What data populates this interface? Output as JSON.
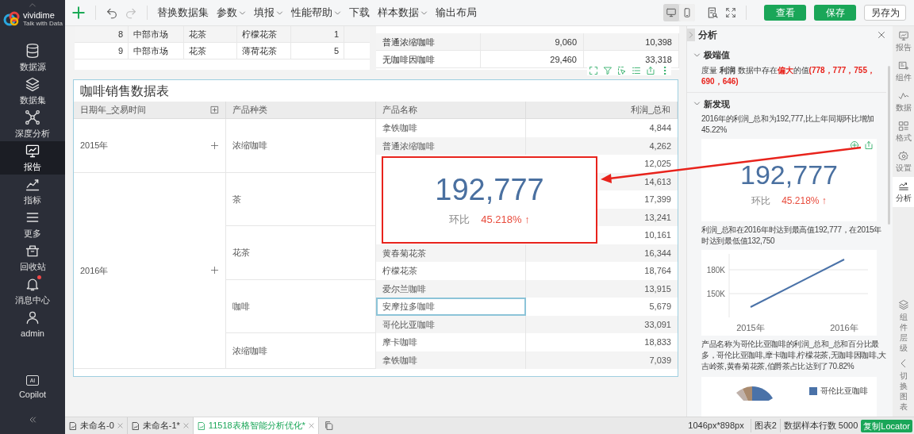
{
  "sidebar": {
    "logo": {
      "name": "vividime",
      "tagline": "Talk with Data"
    },
    "items": [
      {
        "label": "数据源",
        "selected": false,
        "badge": false
      },
      {
        "label": "数据集",
        "selected": false,
        "badge": false
      },
      {
        "label": "深度分析",
        "selected": false,
        "badge": false
      },
      {
        "label": "报告",
        "selected": true,
        "badge": false
      },
      {
        "label": "指标",
        "selected": false,
        "badge": false
      },
      {
        "label": "更多",
        "selected": false,
        "badge": false
      },
      {
        "label": "回收站",
        "selected": false,
        "badge": false
      },
      {
        "label": "消息中心",
        "selected": false,
        "badge": true
      },
      {
        "label": "admin",
        "selected": false,
        "badge": false
      }
    ],
    "copilot": {
      "icon_text": "AI",
      "label": "Copilot"
    }
  },
  "toolbar": {
    "menus": [
      {
        "label": "替换数据集",
        "dropdown": false
      },
      {
        "label": "参数",
        "dropdown": true
      },
      {
        "label": "填报",
        "dropdown": true
      },
      {
        "label": "性能帮助",
        "dropdown": true
      },
      {
        "label": "下载",
        "dropdown": false
      },
      {
        "label": "样本数据",
        "dropdown": true
      },
      {
        "label": "输出布局",
        "dropdown": false
      }
    ],
    "view_modes": [
      {
        "kind": "desktop",
        "selected": true
      },
      {
        "kind": "mobile",
        "selected": false
      }
    ],
    "buttons": [
      {
        "label": "查看",
        "kind": "primary"
      },
      {
        "label": "保存",
        "kind": "primary"
      },
      {
        "label": "另存为",
        "kind": "secondary"
      }
    ]
  },
  "canvas": {
    "top_left_table": {
      "rows": [
        [
          "8",
          "中部市场",
          "花茶",
          "柠檬花茶",
          "1"
        ],
        [
          "9",
          "中部市场",
          "花茶",
          "薄荷花茶",
          "5"
        ]
      ]
    },
    "top_right_table": {
      "rows": [
        [
          "普通浓缩咖啡",
          "9,060",
          "10,398"
        ],
        [
          "无咖啡因咖啡",
          "29,460",
          "33,318"
        ]
      ]
    },
    "widget": {
      "title": "咖啡销售数据表",
      "columns": [
        "日期年_交易时间",
        "产品种类",
        "产品名称",
        "利润_总和"
      ],
      "years": [
        {
          "label": "2015年",
          "categories": [
            {
              "label": "浓缩咖啡",
              "products": [
                {
                  "name": "拿铁咖啡",
                  "value": "4,844",
                  "selected": false
                },
                {
                  "name": "普通浓缩咖啡",
                  "value": "4,262",
                  "selected": false
                },
                {
                  "value": "12,025"
                }
              ]
            }
          ]
        },
        {
          "label": "2016年",
          "categories": [
            {
              "label": "茶",
              "products": [
                {
                  "value": "14,613"
                },
                {
                  "value": "17,399"
                },
                {
                  "value": "13,241"
                }
              ]
            },
            {
              "label": "花茶",
              "products": [
                {
                  "value": "10,161"
                },
                {
                  "name": "黄春菊花茶",
                  "value": "16,344",
                  "selected": false
                },
                {
                  "name": "柠檬花茶",
                  "value": "18,764",
                  "selected": false
                }
              ]
            },
            {
              "label": "咖啡",
              "products": [
                {
                  "name": "爱尔兰咖啡",
                  "value": "13,915",
                  "selected": false
                },
                {
                  "name": "安摩拉多咖啡",
                  "value": "5,679",
                  "selected": true
                },
                {
                  "name": "哥伦比亚咖啡",
                  "value": "33,091",
                  "selected": false
                }
              ]
            },
            {
              "label": "浓缩咖啡",
              "products": [
                {
                  "name": "摩卡咖啡",
                  "value": "18,833",
                  "selected": false
                },
                {
                  "name": "拿铁咖啡",
                  "value": "7,039",
                  "selected": false
                }
              ]
            }
          ]
        }
      ],
      "kpi_overlay": {
        "value": "192,777",
        "compare_label": "环比",
        "compare_value": "45.218% ↑"
      }
    }
  },
  "analysis_panel": {
    "title": "分析",
    "extremes": {
      "title": "极端值",
      "expanded": true,
      "segments": [
        {
          "kind": "plain",
          "text": "度量 "
        },
        {
          "kind": "bold",
          "text": "利润"
        },
        {
          "kind": "plain",
          "text": " 数据中存在"
        },
        {
          "kind": "alert",
          "text": "偏大"
        },
        {
          "kind": "plain",
          "text": "的值"
        },
        {
          "kind": "alert",
          "text": "(778，777，755，690，646)"
        }
      ]
    },
    "findings": {
      "title": "新发现",
      "expanded": true,
      "items": [
        {
          "kind": "text",
          "text": "2016年的利润_总和为192,777,比上年同期环比增加45.22%"
        },
        {
          "kind": "kpi",
          "value": "192,777",
          "compare_label": "环比",
          "compare_value": "45.218% ↑"
        },
        {
          "kind": "text",
          "text": "利润_总和在2016年时达到最高值192,777，在2015年时达到最低值132,750"
        },
        {
          "kind": "line_chart",
          "chart_data": {
            "type": "line",
            "categories": [
              "2015年",
              "2016年"
            ],
            "ylim": [
              120000,
              200000
            ],
            "series": [
              {
                "color": "#4a72a8",
                "values": [
                  133000,
                  193000
                ]
              }
            ],
            "yticks": [
              {
                "value": 150000,
                "label": "150K"
              },
              {
                "value": 180000,
                "label": "180K"
              }
            ]
          }
        },
        {
          "kind": "text",
          "text": "产品名称为哥伦比亚咖啡的利润_总和_总和百分比最多，哥伦比亚咖啡,摩卡咖啡,柠檬花茶,无咖啡因咖啡,大吉岭茶,黄春菊花茶,伯爵茶占比达到了70.82%"
        },
        {
          "kind": "pie_chart",
          "legend": [
            {
              "label": "哥伦比亚咖啡",
              "color": "#4a72a8"
            }
          ]
        }
      ]
    }
  },
  "right_rail": {
    "items": [
      {
        "label": "报告",
        "selected": false
      },
      {
        "label": "组件",
        "selected": false
      },
      {
        "label": "数据",
        "selected": false
      },
      {
        "label": "格式",
        "selected": false
      },
      {
        "label": "设置",
        "selected": false
      },
      {
        "label": "分析",
        "selected": true
      }
    ],
    "vertical_items": [
      {
        "label": "组件层级"
      },
      {
        "label": "切换图表"
      }
    ]
  },
  "status_bar": {
    "tabs": [
      {
        "label": "未命名-0",
        "selected": false
      },
      {
        "label": "未命名-1*",
        "selected": false
      },
      {
        "label": "11518表格智能分析优化*",
        "selected": true
      }
    ],
    "size": "1046px*898px",
    "chart": "图表2",
    "sample_rows": "数据样本行数 5000",
    "locator_button": "复制Locator"
  }
}
